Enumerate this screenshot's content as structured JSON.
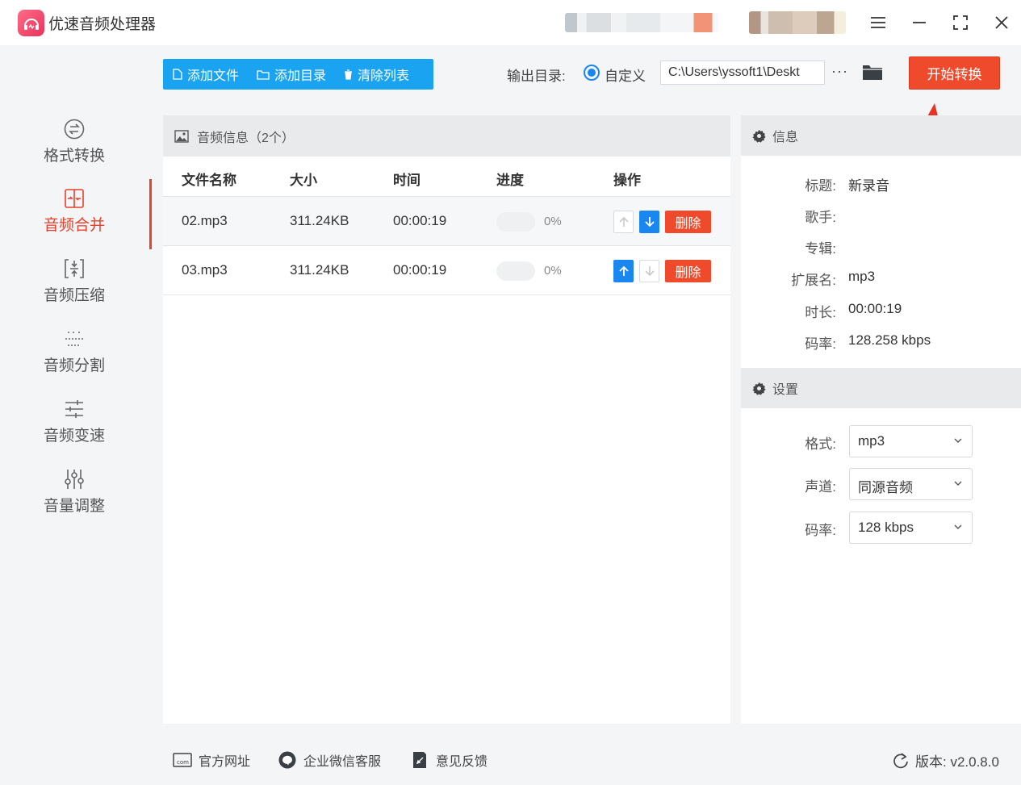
{
  "app": {
    "title": "优速音频处理器"
  },
  "window": {
    "menu_icon": "menu-icon",
    "minimize_icon": "minimize-icon",
    "maximize_icon": "maximize-icon",
    "close_icon": "close-icon"
  },
  "sidebar": {
    "items": [
      {
        "label": "格式转换",
        "icon": "format-convert-icon",
        "active": false
      },
      {
        "label": "音频合并",
        "icon": "audio-merge-icon",
        "active": true
      },
      {
        "label": "音频压缩",
        "icon": "audio-compress-icon",
        "active": false
      },
      {
        "label": "音频分割",
        "icon": "audio-split-icon",
        "active": false
      },
      {
        "label": "音频变速",
        "icon": "audio-speed-icon",
        "active": false
      },
      {
        "label": "音量调整",
        "icon": "volume-adjust-icon",
        "active": false
      }
    ]
  },
  "toolbar": {
    "add_file": "添加文件",
    "add_folder": "添加目录",
    "clear_list": "清除列表",
    "output_label": "输出目录:",
    "custom_label": "自定义",
    "output_path": "C:\\Users\\yssoft1\\Deskt",
    "more": "···",
    "start": "开始转换"
  },
  "file_panel": {
    "title": "音频信息（2个）",
    "columns": [
      "文件名称",
      "大小",
      "时间",
      "进度",
      "操作"
    ],
    "rows": [
      {
        "name": "02.mp3",
        "size": "311.24KB",
        "time": "00:00:19",
        "progress": "0%",
        "delete": "删除"
      },
      {
        "name": "03.mp3",
        "size": "311.24KB",
        "time": "00:00:19",
        "progress": "0%",
        "delete": "删除"
      }
    ]
  },
  "info_panel": {
    "title": "信息",
    "fields": [
      {
        "label": "标题:",
        "value": "新录音"
      },
      {
        "label": "歌手:",
        "value": ""
      },
      {
        "label": "专辑:",
        "value": ""
      },
      {
        "label": "扩展名:",
        "value": "mp3"
      },
      {
        "label": "时长:",
        "value": "00:00:19"
      },
      {
        "label": "码率:",
        "value": "128.258 kbps"
      }
    ]
  },
  "settings_panel": {
    "title": "设置",
    "fields": [
      {
        "label": "格式:",
        "value": "mp3"
      },
      {
        "label": "声道:",
        "value": "同源音频"
      },
      {
        "label": "码率:",
        "value": "128 kbps"
      }
    ]
  },
  "footer": {
    "website": "官方网址",
    "wechat": "企业微信客服",
    "feedback": "意见反馈",
    "version": "版本: v2.0.8.0"
  },
  "colors": {
    "accent_red": "#ef4a2b",
    "accent_blue": "#1aa3f0",
    "select_blue": "#1a86f0"
  }
}
